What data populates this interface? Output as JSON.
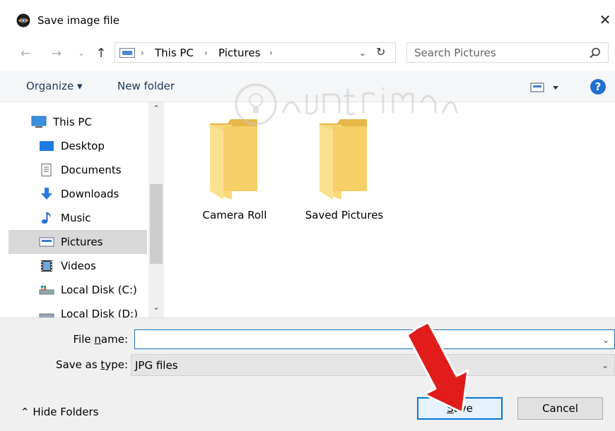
{
  "window": {
    "title": "Save image file",
    "close_glyph": "✕"
  },
  "nav": {
    "back_glyph": "←",
    "forward_glyph": "→",
    "recent_glyph": "⌄",
    "up_glyph": "↑",
    "breadcrumbs": [
      "This PC",
      "Pictures"
    ],
    "crumb_sep": "›",
    "dropdown_glyph": "⌄",
    "refresh_glyph": "↻"
  },
  "search": {
    "placeholder": "Search Pictures"
  },
  "toolbar": {
    "organize_label": "Organize ▾",
    "new_folder_label": "New folder",
    "help_glyph": "?"
  },
  "sidebar": {
    "items": [
      {
        "label": "This PC",
        "icon": "computer-icon"
      },
      {
        "label": "Desktop",
        "icon": "desktop-icon"
      },
      {
        "label": "Documents",
        "icon": "documents-icon"
      },
      {
        "label": "Downloads",
        "icon": "downloads-icon"
      },
      {
        "label": "Music",
        "icon": "music-icon"
      },
      {
        "label": "Pictures",
        "icon": "pictures-icon",
        "selected": true
      },
      {
        "label": "Videos",
        "icon": "videos-icon"
      },
      {
        "label": "Local Disk (C:)",
        "icon": "drive-icon"
      },
      {
        "label": "Local Disk (D:)",
        "icon": "drive-icon"
      }
    ],
    "scroll_up_glyph": "⌃",
    "scroll_down_glyph": "⌄"
  },
  "content": {
    "folders": [
      {
        "label": "Camera Roll"
      },
      {
        "label": "Saved Pictures"
      }
    ]
  },
  "form": {
    "filename_label": "File name:",
    "filename_label_pre": "File ",
    "filename_label_u": "n",
    "filename_label_post": "ame:",
    "filename_value": "",
    "savetype_label": "Save as type:",
    "savetype_label_pre": "Save as ",
    "savetype_label_u": "t",
    "savetype_label_post": "ype:",
    "savetype_value": "JPG files",
    "chevron_glyph": "⌄"
  },
  "footer": {
    "hide_folders_label": "⌃  Hide Folders",
    "save_label": "Save",
    "save_label_u": "S",
    "save_label_post": "ave",
    "cancel_label": "Cancel"
  },
  "colors": {
    "accent": "#0078d7",
    "selection": "#d9d9d9",
    "folder": "#f8d775",
    "arrow": "#e21b1b"
  }
}
